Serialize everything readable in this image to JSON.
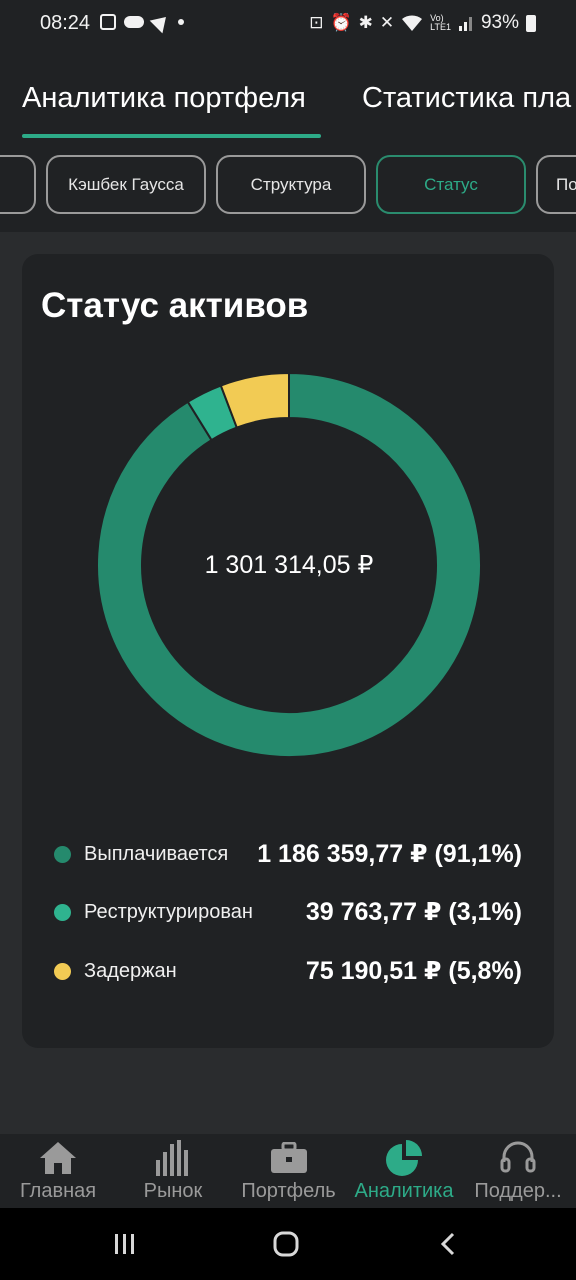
{
  "status_bar": {
    "time": "08:24",
    "battery": "93%",
    "left_icons": [
      "image-icon",
      "cloud-icon",
      "telegram-icon",
      "dot-icon"
    ],
    "right_icons": [
      "lock-icon",
      "alarm-icon",
      "bluetooth-icon",
      "mute-icon",
      "wifi-icon",
      "volte-icon",
      "signal-icon",
      "battery-icon"
    ]
  },
  "header": {
    "tabs": [
      {
        "label": "Аналитика портфеля",
        "active": true
      },
      {
        "label": "Статистика пла",
        "active": false
      }
    ]
  },
  "chips": [
    {
      "label": "",
      "active": false
    },
    {
      "label": "Кэшбек Гаусса",
      "active": false
    },
    {
      "label": "Структура",
      "active": false
    },
    {
      "label": "Статус",
      "active": true
    },
    {
      "label": "По",
      "active": false
    }
  ],
  "card": {
    "title": "Статус активов",
    "total": "1 301 314,05 ₽",
    "legend": [
      {
        "label": "Выплачивается",
        "value": "1 186 359,77 ₽ (91,1%)",
        "color": "#258a6d"
      },
      {
        "label": "Реструктурирован",
        "value": "39 763,77 ₽ (3,1%)",
        "color": "#2fb38f"
      },
      {
        "label": "Задержан",
        "value": "75 190,51 ₽ (5,8%)",
        "color": "#f2cb54"
      }
    ]
  },
  "chart_data": {
    "type": "pie",
    "title": "Статус активов",
    "categories": [
      "Выплачивается",
      "Реструктурирован",
      "Задержан"
    ],
    "values": [
      1186359.77,
      39763.77,
      75190.51
    ],
    "percent": [
      91.1,
      3.1,
      5.8
    ],
    "colors": [
      "#258a6d",
      "#2fb38f",
      "#f2cb54"
    ],
    "center_label": "1 301 314,05 ₽"
  },
  "bottom_nav": [
    {
      "label": "Главная",
      "icon": "home-icon",
      "active": false
    },
    {
      "label": "Рынок",
      "icon": "bar-chart-icon",
      "active": false
    },
    {
      "label": "Портфель",
      "icon": "briefcase-icon",
      "active": false
    },
    {
      "label": "Аналитика",
      "icon": "pie-chart-icon",
      "active": true
    },
    {
      "label": "Поддер...",
      "icon": "headset-icon",
      "active": false
    }
  ],
  "system_nav": {
    "buttons": [
      "recents-icon",
      "home-circle-icon",
      "back-icon"
    ]
  },
  "colors": {
    "accent": "#2dab88",
    "background": "#2a2c2e",
    "surface": "#202224"
  }
}
